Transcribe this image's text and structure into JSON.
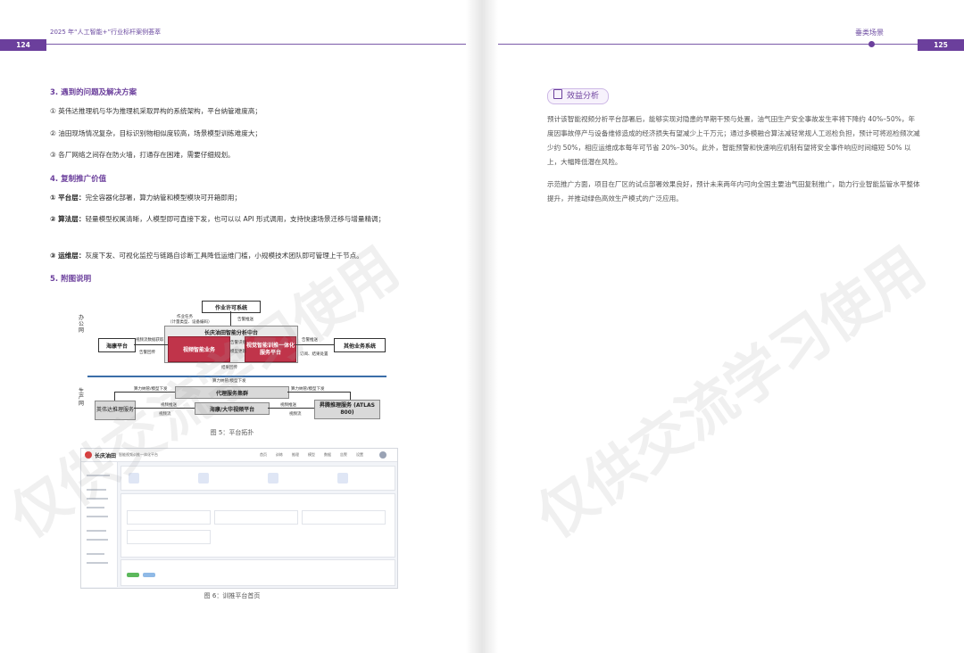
{
  "header": {
    "left_title": "2025 年“人工智能+”行业标杆案例荟萃",
    "right_title": "垂类场景",
    "left_page": "124",
    "right_page": "125"
  },
  "left": {
    "h3": "3. 遇到的问题及解决方案",
    "p1": "① 英伟达推理机与华为推理机采取异构的系统架构，平台纳管难度高；",
    "p2": "② 油田现场情况复杂，目标识别物相似度较高，场景模型训练难度大；",
    "p3": "③ 各厂网络之间存在防火墙，打通存在困难，需要仔细规划。",
    "h4": "4. 复制推广价值",
    "v1_label": "① 平台层：",
    "v1_text": "完全容器化部署，算力纳管和模型模块可开箱即用；",
    "v2_label": "② 算法层：",
    "v2_text": "轻量模型权属清晰，人模型即可直接下发，也可以以 API 形式调用，支持快速场景迁移与增量精调；",
    "v3_label": "③ 运维层：",
    "v3_text": "灰度下发、可视化监控与链路自诊断工具降低运维门槛，小规模技术团队即可管理上千节点。",
    "h5": "5. 附图说明",
    "fig5_caption": "图 5：平台拓扑",
    "fig6_caption": "图 6：训推平台首页"
  },
  "diagram": {
    "zone_office": "办公网",
    "zone_prod": "生产网",
    "permit": "作业许可系统",
    "center": "长庆油田智能分析中台",
    "red_left": "视频智能业务",
    "red_right": "视觉智能训推一体化服务平台",
    "haixiang": "海康平台",
    "other": "其他业务系统",
    "proxy": "代理服务集群",
    "nvidia": "英伟达推理服务",
    "video_platform": "海康/大华视频平台",
    "ascend": "昇腾推理服务 (ATLAS 800)",
    "l_task": "作业任务",
    "l_task2": "（计量类型、设备编码）",
    "l_alarm": "告警推送",
    "l_video": "视频流数据获取",
    "l_alarmpush": "告警回传",
    "l_recog": "告警识别",
    "l_model": "模型更新",
    "l_stream": "获取视频",
    "l_push": "告警推送",
    "l_sub": "订阅、结果处置",
    "l_res": "结果回传",
    "l_compute": "算力纳管/模型下发",
    "l_compute2": "算力纳管/模型下发",
    "l_compute3": "算力纳管/模型下发",
    "l_getstream": "视频推送",
    "l_getstream2": "视频推送",
    "l_flow1": "视频流",
    "l_flow2": "视频流"
  },
  "screenshot": {
    "brand": "长庆油田",
    "subtitle": "智能视频训推一体化平台",
    "menu": [
      "首页",
      "训练",
      "推理",
      "模型",
      "数据",
      "告警",
      "设置"
    ]
  },
  "right": {
    "badge": "效益分析",
    "para1": "预计该智能视频分析平台部署后，能够实现对隐患的早期干预与处置，油气田生产安全事故发生率将下降约 40%–50%，年度因事故停产与设备维修造成的经济损失有望减少上千万元；通过多模融合算法减轻常规人工巡检负担，预计可将巡检频次减少约 50%，相应运维成本每年可节省 20%–30%。此外，智能预警和快速响应机制有望将安全事件响应时间缩短 50% 以上，大幅降低潜在风险。",
    "para2": "示范推广方面，项目在厂区的试点部署效果良好，预计未来两年内可向全国主要油气田复制推广，助力行业智能监管水平整体提升，并推动绿色高效生产模式的广泛应用。"
  },
  "watermark": "仅供交流学习使用"
}
